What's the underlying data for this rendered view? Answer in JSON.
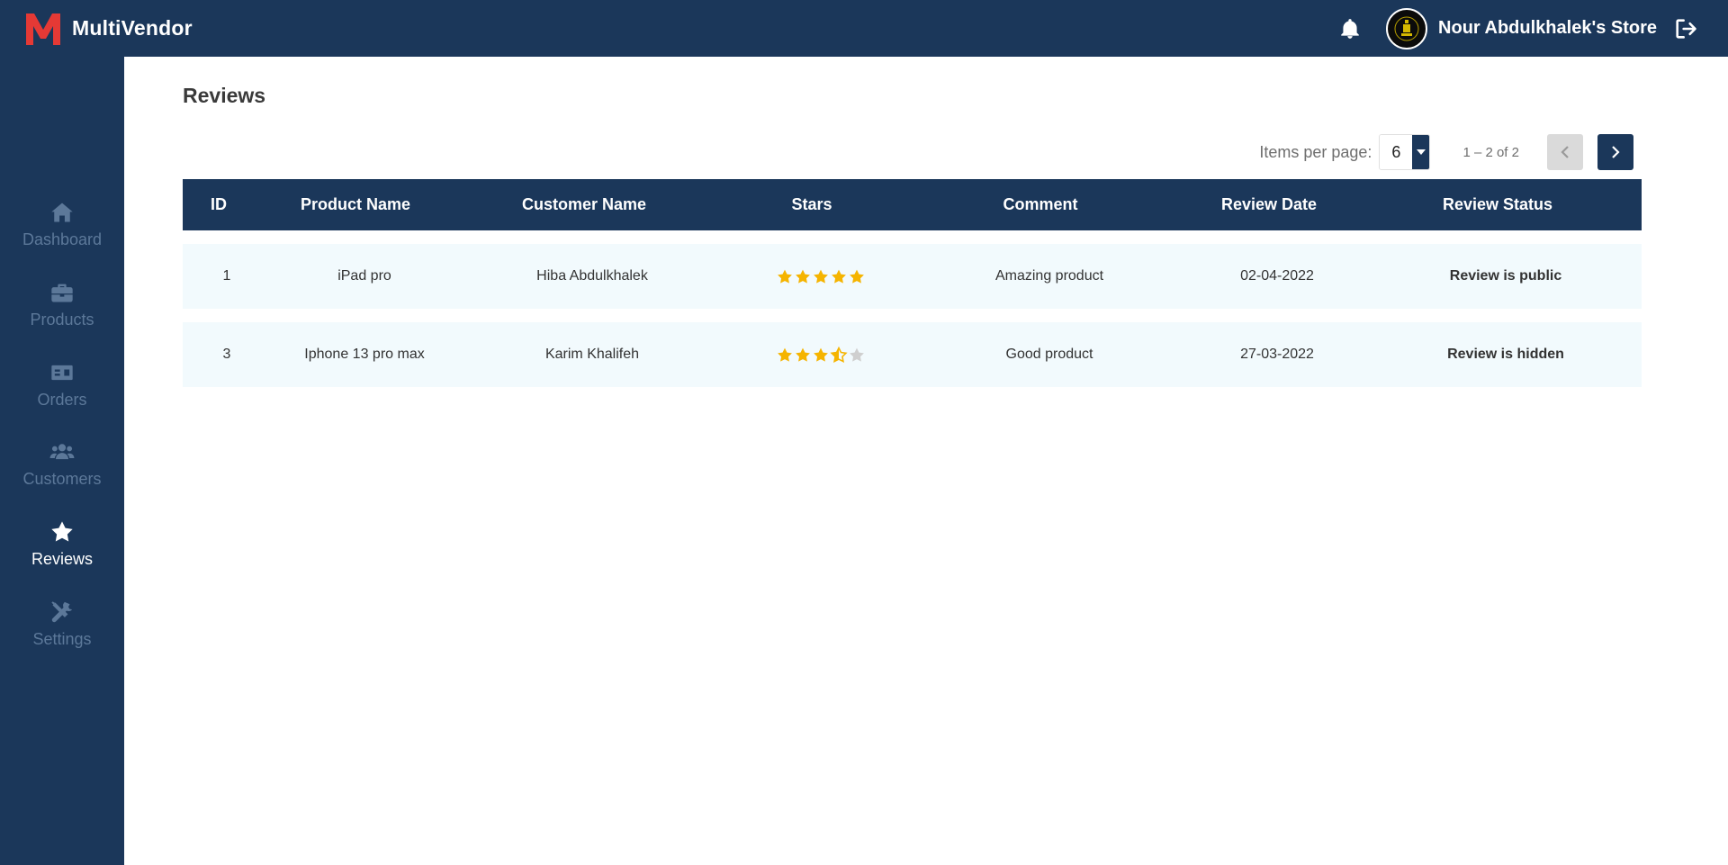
{
  "brand": {
    "letter": "M",
    "name": "MultiVendor",
    "color": "#e53935"
  },
  "header": {
    "store_name": "Nour Abdulkhalek's Store",
    "background": "#1b375a"
  },
  "icons": {
    "notifications": "bell-icon",
    "logout": "logout-icon",
    "avatar": "store-logo"
  },
  "sidebar": {
    "items": [
      {
        "label": "Dashboard",
        "icon": "home-icon",
        "active": false
      },
      {
        "label": "Products",
        "icon": "briefcase-icon",
        "active": false
      },
      {
        "label": "Orders",
        "icon": "money-bill-icon",
        "active": false
      },
      {
        "label": "Customers",
        "icon": "users-icon",
        "active": false
      },
      {
        "label": "Reviews",
        "icon": "star-icon",
        "active": true
      },
      {
        "label": "Settings",
        "icon": "tools-icon",
        "active": false
      }
    ]
  },
  "main": {
    "title": "Reviews",
    "paginator": {
      "items_per_page_label": "Items per page:",
      "items_per_page_value": "6",
      "range_label": "1 – 2 of 2"
    },
    "table": {
      "columns": [
        "ID",
        "Product Name",
        "Customer Name",
        "Stars",
        "Comment",
        "Review Date",
        "Review Status"
      ],
      "rows": [
        {
          "id": "1",
          "product": "iPad pro",
          "customer": "Hiba Abdulkhalek",
          "stars": 5,
          "comment": "Amazing product",
          "date": "02-04-2022",
          "status": "Review is public"
        },
        {
          "id": "3",
          "product": "Iphone 13 pro max",
          "customer": "Karim Khalifeh",
          "stars": 3.5,
          "comment": "Good product",
          "date": "27-03-2022",
          "status": "Review is hidden"
        }
      ]
    }
  },
  "colors": {
    "star_filled": "#f5b400",
    "star_empty": "#cfcfcf",
    "row_bg": "#f2fafd"
  }
}
